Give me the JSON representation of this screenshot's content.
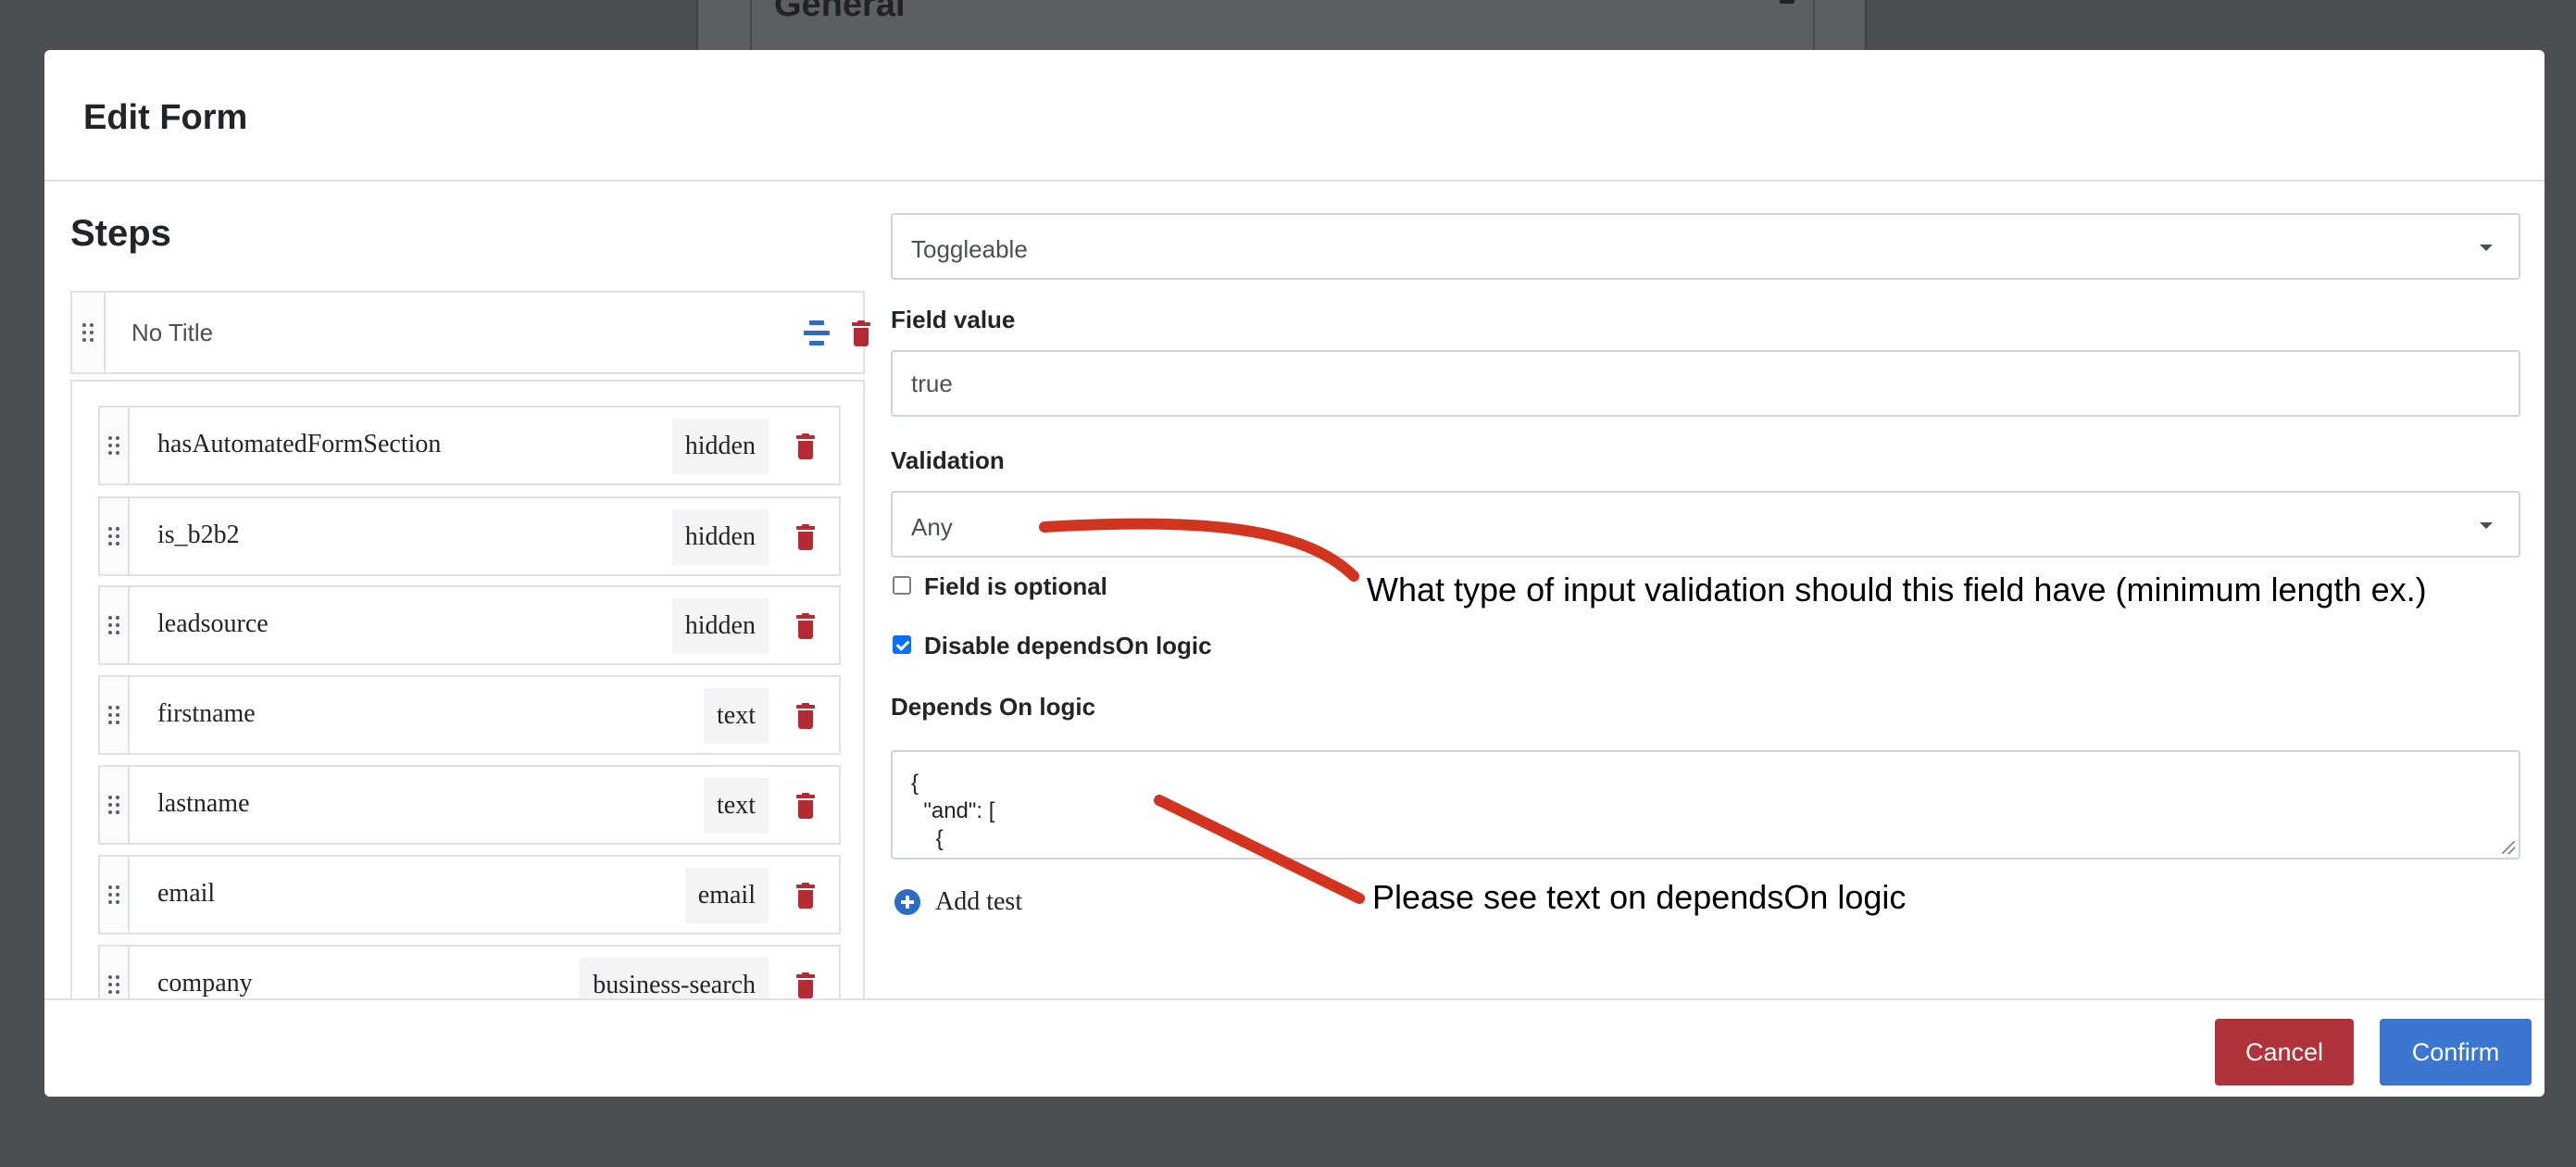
{
  "background": {
    "title": "General"
  },
  "modal": {
    "title": "Edit Form"
  },
  "steps": {
    "title": "Steps",
    "step_title": "No Title",
    "fields": [
      {
        "name": "hasAutomatedFormSection",
        "type": "hidden"
      },
      {
        "name": "is_b2b2",
        "type": "hidden"
      },
      {
        "name": "leadsource",
        "type": "hidden"
      },
      {
        "name": "firstname",
        "type": "text"
      },
      {
        "name": "lastname",
        "type": "text"
      },
      {
        "name": "email",
        "type": "email"
      },
      {
        "name": "company",
        "type": "business-search"
      }
    ]
  },
  "form": {
    "toggle_select": {
      "value": "Toggleable"
    },
    "field_value": {
      "label": "Field value",
      "value": "true"
    },
    "validation": {
      "label": "Validation",
      "value": "Any"
    },
    "optional": {
      "label": "Field is optional",
      "checked": false
    },
    "disable_depends": {
      "label": "Disable dependsOn logic",
      "checked": true
    },
    "depends_on": {
      "label": "Depends On logic",
      "lines": [
        "{",
        "  \"and\": [",
        "    {"
      ]
    },
    "add_test": "Add test"
  },
  "annotations": {
    "validation_note": "What type of input validation should this field have (minimum length ex.)",
    "depends_note": "Please see text on dependsOn logic",
    "color": "#d2341f"
  },
  "footer": {
    "cancel": "Cancel",
    "confirm": "Confirm"
  },
  "colors": {
    "cancel": "#b0323b",
    "confirm": "#3b76d1",
    "delete": "#b52a33",
    "overlay": "#4b4f53"
  }
}
